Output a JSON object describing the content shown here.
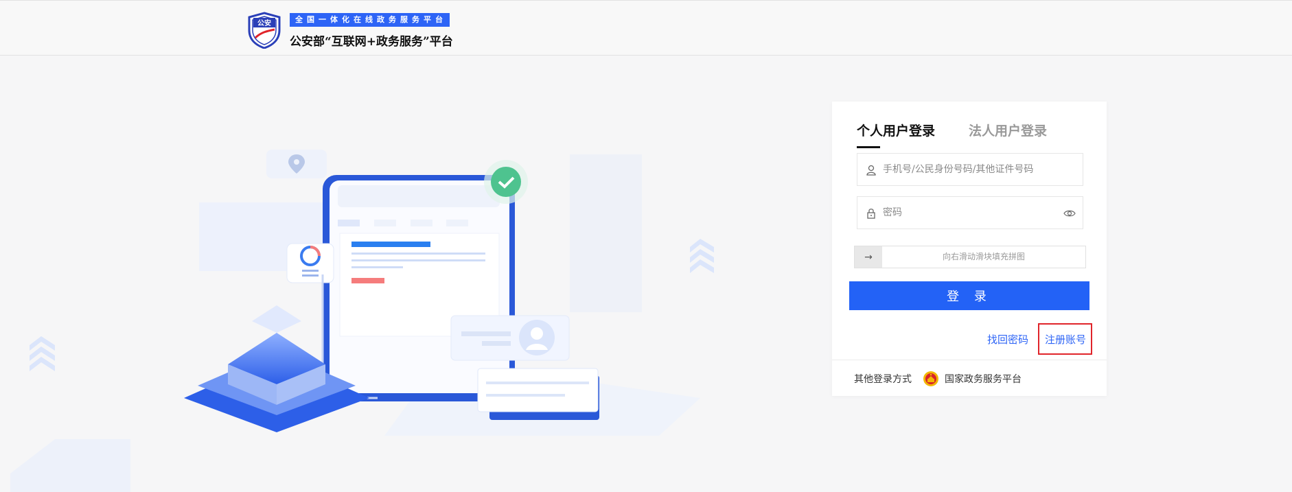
{
  "header": {
    "tagline": "全国一体化在线政务服务平台",
    "platform_name": "公安部“互联网+政务服务”平台",
    "logo_text": "公安"
  },
  "login": {
    "tabs": [
      {
        "label": "个人用户登录",
        "active": true
      },
      {
        "label": "法人用户登录",
        "active": false
      }
    ],
    "username_placeholder": "手机号/公民身份号码/其他证件号码",
    "password_placeholder": "密码",
    "slider_hint": "向右滑动滑块填充拼图",
    "slider_handle_icon": "→",
    "login_button": "登 录",
    "forgot_password": "找回密码",
    "register": "注册账号",
    "other_methods_label": "其他登录方式",
    "gov_platform": "国家政务服务平台"
  },
  "colors": {
    "accent": "#2362f6",
    "highlight_border": "#e0242a"
  }
}
